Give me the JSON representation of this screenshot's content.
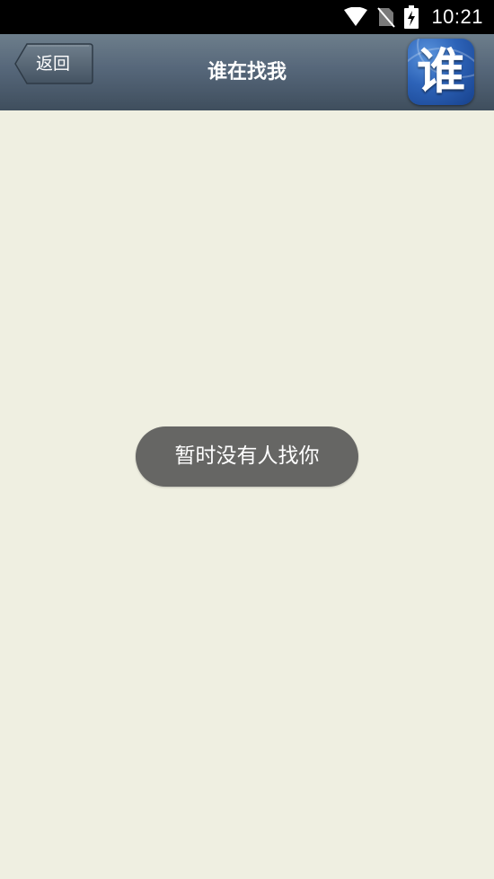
{
  "status_bar": {
    "time": "10:21",
    "icons": [
      "wifi-icon",
      "no-sim-icon",
      "battery-charging-icon"
    ]
  },
  "title_bar": {
    "back_label": "返回",
    "title": "谁在找我",
    "logo_text": "谁"
  },
  "toast": {
    "message": "暂时没有人找你"
  },
  "colors": {
    "background": "#efefe1",
    "title_bar_top": "#6d7e8b",
    "title_bar_bottom": "#3f4e5d",
    "toast_bg": "#666664",
    "logo_blue": "#2d63b8"
  }
}
